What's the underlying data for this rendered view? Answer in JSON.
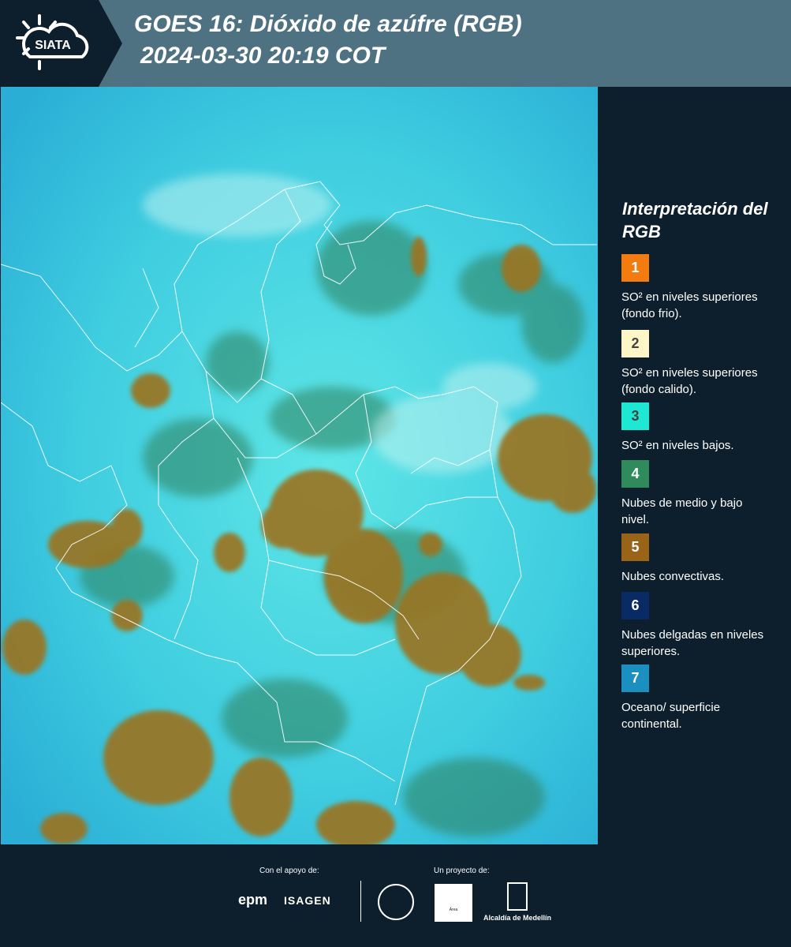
{
  "header": {
    "logo_text": "SIATA",
    "title_line1": "GOES 16: Dióxido de azúfre (RGB)",
    "title_line2": "2024-03-30 20:19 COT"
  },
  "legend": {
    "title": "Interpretación del RGB",
    "items": [
      {
        "number": "1",
        "color": "#f47b0f",
        "text": "SO² en niveles superiores (fondo frio)."
      },
      {
        "number": "2",
        "color": "#fdf6c6",
        "text": "SO² en niveles superiores (fondo calido)."
      },
      {
        "number": "3",
        "color": "#1ee8d4",
        "text": "SO² en niveles bajos."
      },
      {
        "number": "4",
        "color": "#2f8a5c",
        "text": "Nubes de medio y bajo nivel."
      },
      {
        "number": "5",
        "color": "#9a6418",
        "text": "Nubes convectivas."
      },
      {
        "number": "6",
        "color": "#0a2a66",
        "text": "Nubes delgadas en niveles superiores."
      },
      {
        "number": "7",
        "color": "#1b8fc0",
        "text": "Oceano/ superficie continental."
      }
    ]
  },
  "map": {
    "icon": "satellite-rgb-image"
  },
  "footer": {
    "support_label": "Con el apoyo de:",
    "project_label": "Un proyecto de:",
    "epm_logo": "epm",
    "isagen_logo": "ISAGEN",
    "area_logo": "Área",
    "alcaldia_logo": "Alcaldía de Medellín"
  }
}
